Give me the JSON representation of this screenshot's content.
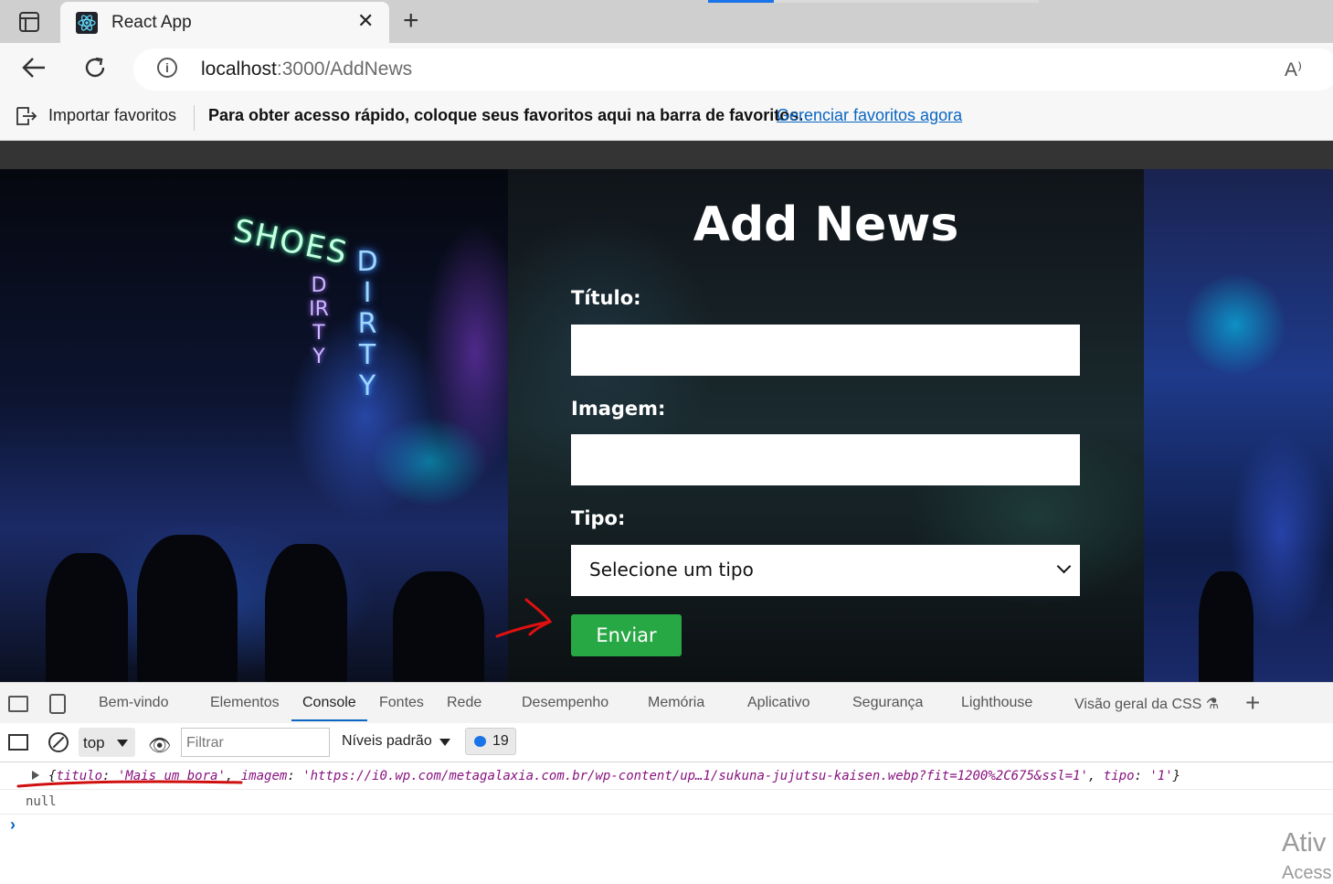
{
  "browser": {
    "tab_title": "React App",
    "tab_close": "✕",
    "new_tab": "+",
    "url_host": "localhost",
    "url_path": ":3000/AddNews",
    "read_aloud": "A⁾",
    "favorites": {
      "import_label": "Importar favoritos",
      "message": "Para obter acesso rápido, coloque seus favoritos aqui na barra de favoritos.",
      "manage_link": "Gerenciar favoritos agora"
    }
  },
  "page": {
    "title": "Add News",
    "neon_shoes": "SHOES",
    "neon_dirty": "DIRTY",
    "form": {
      "titulo_label": "Título:",
      "titulo_value": "",
      "imagem_label": "Imagem:",
      "imagem_value": "",
      "tipo_label": "Tipo:",
      "tipo_selected": "Selecione um tipo",
      "submit_label": "Enviar"
    },
    "colors": {
      "submit_bg": "#28a745",
      "annotation": "#e01010"
    }
  },
  "devtools": {
    "tabs": [
      "Bem-vindo",
      "Elementos",
      "Console",
      "Fontes",
      "Rede",
      "Desempenho",
      "Memória",
      "Aplicativo",
      "Segurança",
      "Lighthouse",
      "Visão geral da CSS ⚗"
    ],
    "active_tab": "Console",
    "context": "top",
    "filter_placeholder": "Filtrar",
    "levels": "Níveis padrão",
    "issues_count": "19",
    "log": {
      "open": "{",
      "k1": "titulo",
      "v1": "'Mais um bora'",
      "k2": "imagem",
      "v2": "'https://i0.wp.com/metagalaxia.com.br/wp-content/up…1/sukuna-jujutsu-kaisen.webp?fit=1200%2C675&ssl=1'",
      "k3": "tipo",
      "v3": "'1'",
      "close": "}",
      "null_line": "null"
    },
    "prompt": "›"
  },
  "os_watermark": {
    "line1": "Ativ",
    "line2": "Acess"
  }
}
